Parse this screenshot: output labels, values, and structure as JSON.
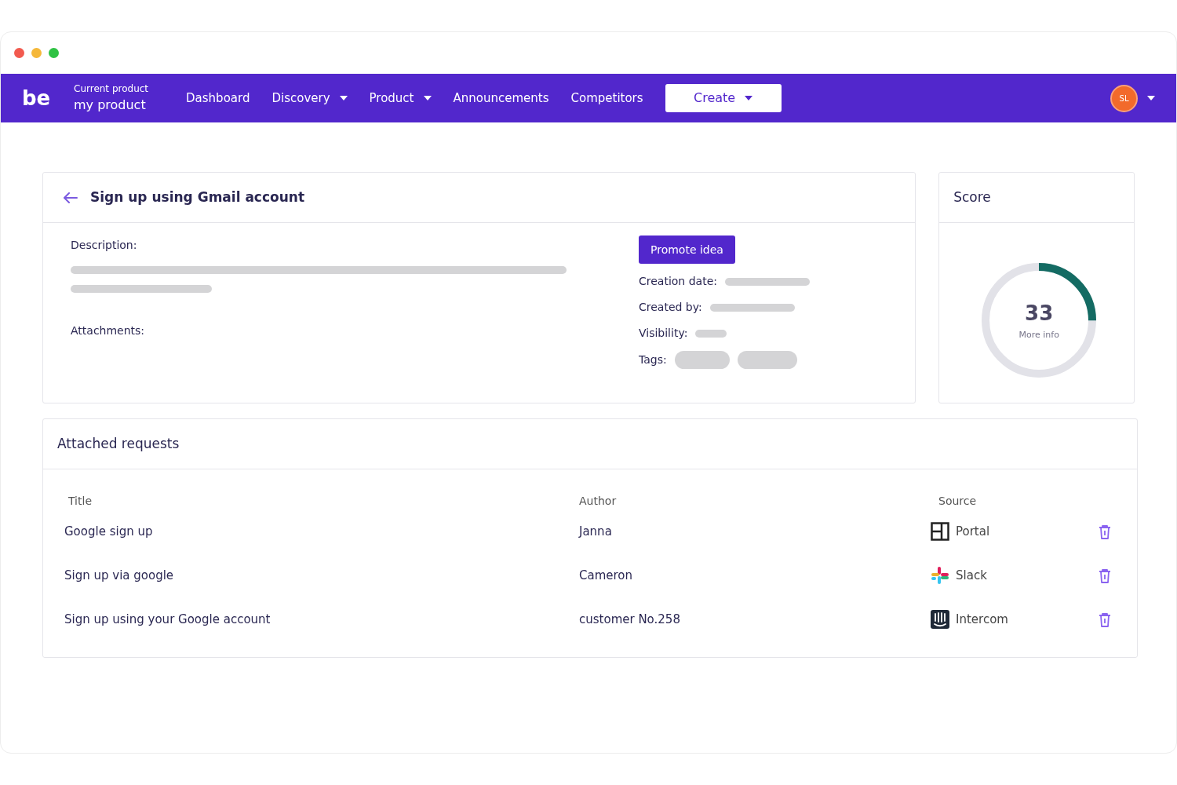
{
  "nav": {
    "logo": "be",
    "product_label": "Current product",
    "product_name": "my product",
    "items": [
      {
        "label": "Dashboard",
        "dropdown": false
      },
      {
        "label": "Discovery",
        "dropdown": true
      },
      {
        "label": "Product",
        "dropdown": true
      },
      {
        "label": "Announcements",
        "dropdown": false
      },
      {
        "label": "Competitors",
        "dropdown": false
      }
    ],
    "create_button": "Create",
    "avatar": "SL"
  },
  "idea": {
    "title": "Sign up using Gmail account",
    "description_label": "Description:",
    "attachments_label": "Attachments:",
    "promote_button": "Promote idea",
    "fields": [
      {
        "label": "Creation date:"
      },
      {
        "label": "Created by:"
      },
      {
        "label": "Visibility:"
      }
    ],
    "tags_label": "Tags:"
  },
  "score": {
    "title": "Score",
    "value": "33",
    "link": "More info",
    "level": 0.25
  },
  "requests": {
    "title": "Attached requests",
    "columns": [
      "Title",
      "Author",
      "Source"
    ],
    "rows": [
      {
        "title": "Google sign up",
        "author": "Janna",
        "source": "Portal",
        "kind": "portal"
      },
      {
        "title": "Sign up via google",
        "author": "Cameron",
        "source": "Slack",
        "kind": "slack"
      },
      {
        "title": "Sign up using your Google account",
        "author": "customer No.258",
        "source": "Intercom",
        "kind": "intercom"
      }
    ]
  }
}
